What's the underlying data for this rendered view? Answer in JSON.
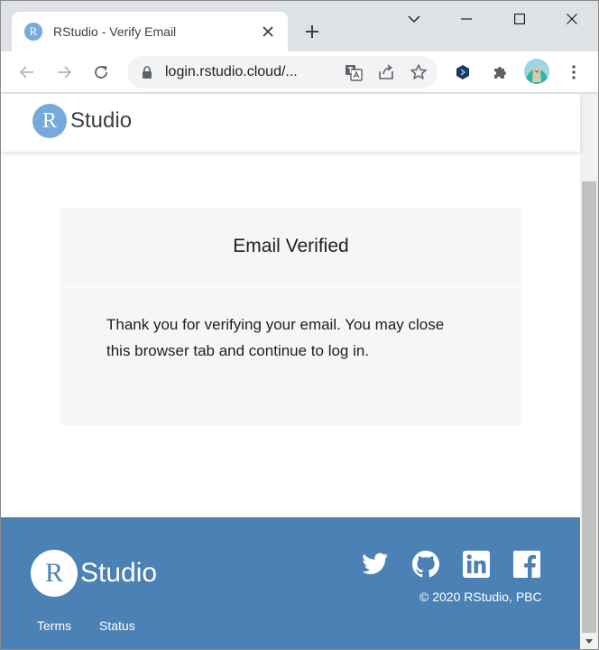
{
  "browser": {
    "tab": {
      "title": "RStudio - Verify Email",
      "favicon_letter": "R",
      "favicon_color": "#75aadb",
      "close_icon": "close-icon"
    },
    "new_tab_icon": "plus-icon",
    "window_controls": [
      "chevron-down-icon",
      "minimize-icon",
      "maximize-icon",
      "close-icon"
    ],
    "toolbar": {
      "back_icon": "arrow-left-icon",
      "forward_icon": "arrow-right-icon",
      "reload_icon": "reload-icon",
      "url": "login.rstudio.cloud/...",
      "omnibox_icons": [
        "lock-icon",
        "translate-icon",
        "share-icon",
        "star-icon"
      ],
      "extension_icons": [
        "extension-icon",
        "puzzle-icon",
        "avatar",
        "more-vert-icon"
      ]
    }
  },
  "page": {
    "header_logo": {
      "letter": "R",
      "word": "Studio"
    },
    "card": {
      "title": "Email Verified",
      "body": "Thank you for verifying your email. You may close this browser tab and continue to log in."
    },
    "footer": {
      "logo": {
        "letter": "R",
        "word": "Studio"
      },
      "social_icons": [
        "twitter-icon",
        "github-icon",
        "linkedin-icon",
        "facebook-icon"
      ],
      "copyright": "© 2020 RStudio, PBC",
      "links": [
        "Terms",
        "Status"
      ]
    }
  },
  "colors": {
    "accent": "#75aadb",
    "footer_bg": "#4b81b5",
    "card_bg": "#f6f6f6"
  }
}
